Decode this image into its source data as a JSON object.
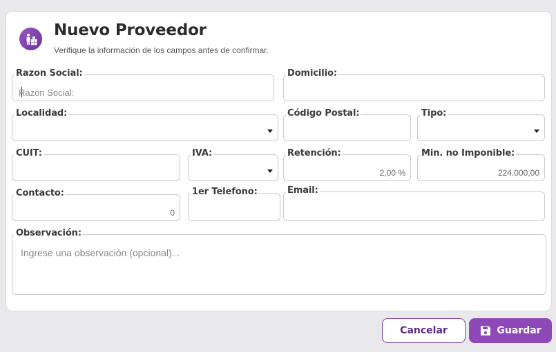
{
  "header": {
    "title": "Nuevo Proveedor",
    "subtitle": "Verifique la información de los campos antes de confirmar.",
    "icon": "supplier-icon"
  },
  "form": {
    "razon_social": {
      "label": "Razon Social:",
      "placeholder": "Razon Social:"
    },
    "domicilio": {
      "label": "Domicilio:"
    },
    "localidad": {
      "label": "Localidad:"
    },
    "codigo_postal": {
      "label": "Código Postal:"
    },
    "tipo": {
      "label": "Tipo:"
    },
    "cuit": {
      "label": "CUIT:"
    },
    "iva": {
      "label": "IVA:"
    },
    "retencion": {
      "label": "Retención:",
      "value": "2,00 %"
    },
    "min_no_imponible": {
      "label": "Min. no Imponible:",
      "value": "224.000,00"
    },
    "contacto": {
      "label": "Contacto:",
      "value": "0"
    },
    "telefono": {
      "label": "1er Telefono:"
    },
    "email": {
      "label": "Email:"
    },
    "observacion": {
      "label": "Observación:",
      "placeholder": "Ingrese una observación (opcional)..."
    }
  },
  "actions": {
    "cancel_label": "Cancelar",
    "save_label": "Guardar"
  },
  "colors": {
    "accent": "#8e48b8",
    "accent_dark": "#5a2a80"
  }
}
